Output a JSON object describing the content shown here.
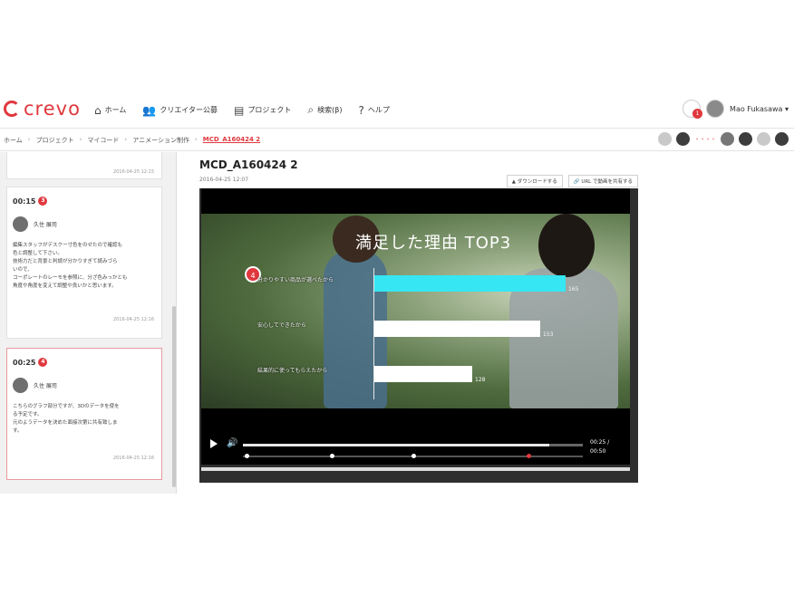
{
  "header": {
    "logo_text": "crevo",
    "nav": [
      {
        "icon": "home-icon",
        "glyph": "⌂",
        "label": "ホーム"
      },
      {
        "icon": "users-icon",
        "glyph": "👥",
        "label": "クリエイター公募"
      },
      {
        "icon": "project-icon",
        "glyph": "▤",
        "label": "プロジェクト"
      },
      {
        "icon": "search-icon",
        "glyph": "⌕",
        "label": "検索(β)"
      },
      {
        "icon": "help-icon",
        "glyph": "?",
        "label": "ヘルプ"
      }
    ],
    "notification_count": "1",
    "user_name": "Mao Fukasawa ▾"
  },
  "breadcrumb": {
    "items": [
      "ホーム",
      "プロジェクト",
      "マイコード",
      "アニメーション制作"
    ],
    "current": "MCD_A160424 2",
    "separator": "›"
  },
  "members": {
    "label": "・・・・"
  },
  "sidebar": {
    "top_card_date": "2016-04-25 12:15",
    "comments": [
      {
        "time": "00:15",
        "badge": "3",
        "name": "久住 展司",
        "lines": [
          "編集スタッフがデスクー寸色をのせたので確認も",
          "色と調整して下さい。",
          "技術力だと背景と判読が分かりすぎて読みづら",
          "いので、",
          "コーポレートのレーモを参照に、分ざ色みっかとも",
          "角度や角度を変えて調整や良いかと思います。"
        ],
        "date": "2016-04-25 12:16"
      },
      {
        "time": "00:25",
        "badge": "4",
        "name": "久住 展司",
        "lines": [
          "こちらのグラフ部分ですが、3Dのデータを使を",
          "る予定です。",
          "元のようデータを決めた面接次第に共有致しま",
          "す。"
        ],
        "date": "2016-04-25 12:16"
      }
    ]
  },
  "main": {
    "title": "MCD_A160424 2",
    "date": "2016-04-25 12:07",
    "download_label": "▲ ダウンロードする",
    "url_label": "🔗 URL で動画を共有する"
  },
  "video": {
    "overlay_title": "満足した理由 TOP3",
    "rank_badge": "4",
    "colors": {
      "accent": "#e0383e",
      "highlight_bar": "#36e6f2",
      "bar": "#ffffff"
    },
    "bars": [
      {
        "label": "分かりやすい商品が選べたから",
        "value_label": "165",
        "fraction": 0.98,
        "highlight": true
      },
      {
        "label": "安心してできたから",
        "value_label": "153",
        "fraction": 0.85,
        "highlight": false
      },
      {
        "label": "結果的に使ってもらえたから",
        "value_label": "128",
        "fraction": 0.5,
        "highlight": false
      }
    ],
    "timecode_current": "00:25 /",
    "timecode_total": "00:50",
    "progress": 0.9,
    "markers": [
      {
        "position": 0.01,
        "color": "white"
      },
      {
        "position": 0.26,
        "color": "white"
      },
      {
        "position": 0.5,
        "color": "white"
      },
      {
        "position": 0.84,
        "color": "red"
      }
    ]
  }
}
